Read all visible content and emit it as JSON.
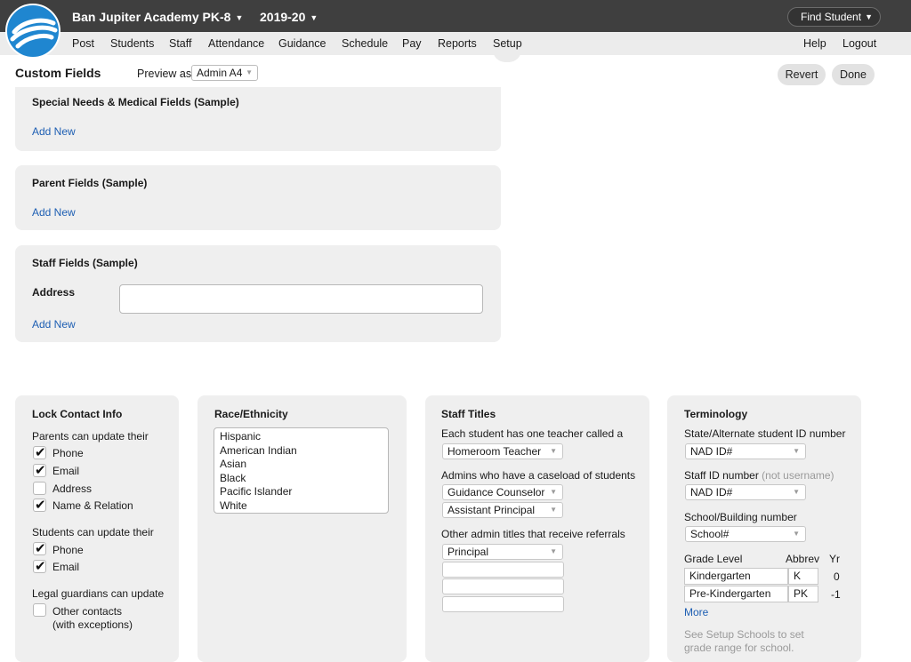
{
  "header": {
    "school": "Ban Jupiter Academy PK-8",
    "year": "2019-20",
    "find_student": "Find Student"
  },
  "nav": {
    "items": [
      "Post",
      "Students",
      "Staff",
      "Attendance",
      "Guidance",
      "Schedule",
      "Pay",
      "Reports",
      "Setup"
    ],
    "help": "Help",
    "logout": "Logout"
  },
  "page": {
    "title": "Custom Fields",
    "preview_label": "Preview as",
    "preview_value": "Admin A4",
    "revert": "Revert",
    "done": "Done"
  },
  "panels": {
    "special": {
      "title": "Special Needs & Medical Fields  (Sample)",
      "add_new": "Add New"
    },
    "parent": {
      "title": "Parent Fields  (Sample)",
      "add_new": "Add New"
    },
    "staff": {
      "title": "Staff Fields  (Sample)",
      "field_label": "Address",
      "field_value": "",
      "add_new": "Add New"
    }
  },
  "lock_contact": {
    "title": "Lock Contact Info",
    "parents_label": "Parents can update their",
    "parents": [
      {
        "label": "Phone",
        "checked": true
      },
      {
        "label": "Email",
        "checked": true
      },
      {
        "label": "Address",
        "checked": false
      },
      {
        "label": "Name & Relation",
        "checked": true
      }
    ],
    "students_label": "Students can update their",
    "students": [
      {
        "label": "Phone",
        "checked": true
      },
      {
        "label": "Email",
        "checked": true
      }
    ],
    "guardians_label": "Legal guardians can update",
    "guardians": [
      {
        "label": "Other contacts",
        "sublabel": "(with exceptions)",
        "checked": false
      }
    ]
  },
  "race": {
    "title": "Race/Ethnicity",
    "options": [
      "Hispanic",
      "American Indian",
      "Asian",
      "Black",
      "Pacific Islander",
      "White"
    ]
  },
  "staff_titles": {
    "title": "Staff Titles",
    "teacher_label": "Each student has one teacher called a",
    "teacher_value": "Homeroom Teacher",
    "admins_label": "Admins who have a caseload of students",
    "admin_values": [
      "Guidance Counselor",
      "Assistant Principal"
    ],
    "other_label": "Other admin titles that receive referrals",
    "other_value": "Principal"
  },
  "terminology": {
    "title": "Terminology",
    "state_id_label": "State/Alternate student ID number",
    "state_id_value": "NAD ID#",
    "staff_id_label": "Staff ID number",
    "staff_id_hint": "(not username)",
    "staff_id_value": "NAD ID#",
    "school_num_label": "School/Building number",
    "school_num_value": "School#",
    "grade_col": "Grade Level",
    "abbrev_col": "Abbrev",
    "yr_col": "Yr",
    "grades": [
      {
        "name": "Kindergarten",
        "abbrev": "K",
        "yr": "0"
      },
      {
        "name": "Pre-Kindergarten",
        "abbrev": "PK",
        "yr": "-1"
      }
    ],
    "more": "More",
    "note_line1": "See Setup Schools to set",
    "note_line2": "grade range for school."
  },
  "colors": {
    "topbar": "#3f3f3f",
    "navbar": "#ececec",
    "panel": "#efefef",
    "link": "#1e5fb3",
    "logo": "#1f86d0"
  }
}
